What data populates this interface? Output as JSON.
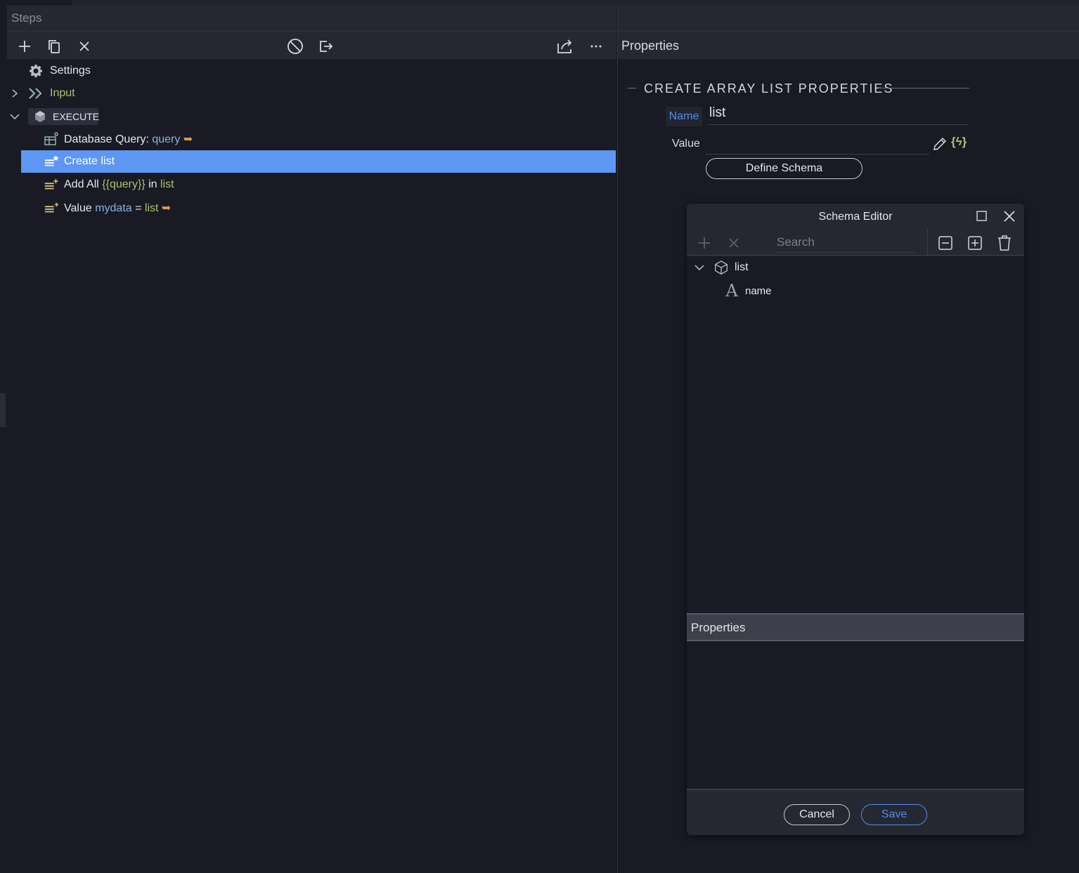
{
  "steps_panel": {
    "header": "Steps",
    "toolbar": {
      "add": "plus-icon",
      "duplicate": "copy-icon",
      "remove": "close-icon",
      "disable": "disable-icon",
      "export": "export-icon",
      "share": "share-icon",
      "more": "more-icon"
    },
    "items": [
      {
        "label": "Settings",
        "icon": "gear-icon"
      },
      {
        "label": "Input",
        "icon": "input-icon"
      },
      {
        "label": "EXECUTE",
        "icon": "cube-icon"
      },
      {
        "label": "Database Query:",
        "value": "query",
        "icon": "database-query-icon"
      },
      {
        "label": "Create list",
        "icon": "create-list-icon",
        "selected": true
      },
      {
        "label": "Add All",
        "value": "{{query}}",
        "mid": "in",
        "target": "list",
        "icon": "add-list-icon"
      },
      {
        "label": "Value",
        "value": "mydata",
        "mid": "=",
        "target": "list",
        "icon": "set-value-icon"
      }
    ]
  },
  "properties_panel": {
    "title": "Properties",
    "section_title": "CREATE ARRAY LIST PROPERTIES",
    "name_label": "Name",
    "name_value": "list",
    "value_label": "Value",
    "value_value": "",
    "dynamic_icon": "{ϟ}",
    "define_schema_label": "Define Schema"
  },
  "schema_editor": {
    "title": "Schema Editor",
    "search_placeholder": "Search",
    "tree": [
      {
        "label": "list",
        "icon": "cube-icon"
      },
      {
        "label": "name",
        "icon": "text-type-icon"
      }
    ],
    "properties_header": "Properties",
    "cancel_label": "Cancel",
    "save_label": "Save"
  },
  "colors": {
    "selection": "#5d97f2",
    "accent_blue": "#4f8ef0",
    "variable_blue": "#84b4e6",
    "green": "#a8c470",
    "orange": "#e19a58"
  }
}
